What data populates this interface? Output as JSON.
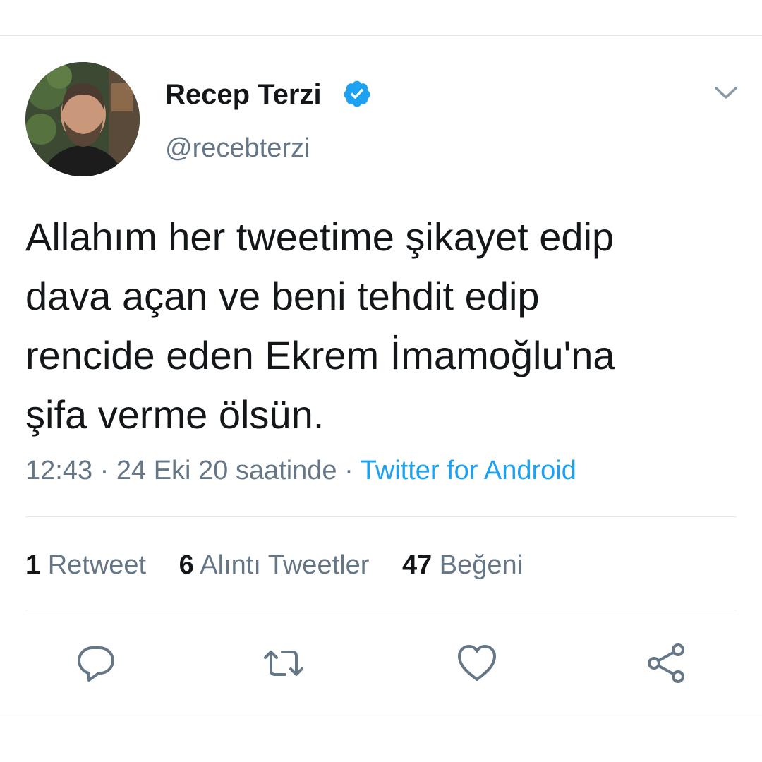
{
  "author": {
    "display_name": "Recep Terzi",
    "handle": "@recebterzi",
    "verified": true
  },
  "tweet": {
    "text_lines": [
      "Allahım her tweetime şikayet edip",
      "dava açan ve beni tehdit edip",
      "rencide eden Ekrem İmamoğlu'na",
      "şifa verme ölsün."
    ],
    "time": "12:43",
    "date_text": "24 Eki 20 saatinde",
    "separator": "·",
    "source": "Twitter for Android"
  },
  "stats": {
    "retweets_count": "1",
    "retweets_label": "Retweet",
    "quotes_count": "6",
    "quotes_label": "Alıntı Tweetler",
    "likes_count": "47",
    "likes_label": "Beğeni"
  },
  "actions": {
    "reply_icon": "reply-icon",
    "retweet_icon": "retweet-icon",
    "like_icon": "heart-icon",
    "share_icon": "share-icon"
  },
  "colors": {
    "text": "#14171a",
    "secondary": "#657786",
    "link": "#1da1f2",
    "divider": "#e1e8ed"
  }
}
